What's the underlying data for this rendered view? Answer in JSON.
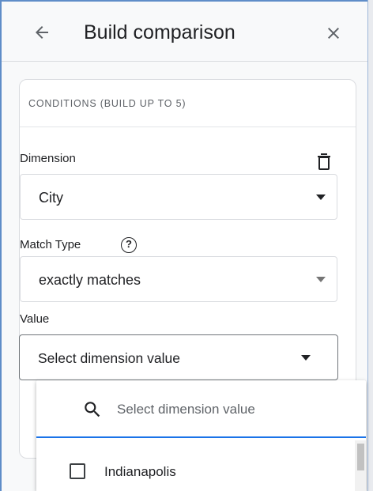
{
  "header": {
    "title": "Build comparison",
    "back_icon": "arrow-back-icon",
    "close_icon": "close-icon"
  },
  "conditions": {
    "heading": "CONDITIONS (BUILD UP TO 5)",
    "dimension": {
      "label": "Dimension",
      "value": "City",
      "delete_icon": "trash-icon"
    },
    "match_type": {
      "label": "Match Type",
      "value": "exactly matches",
      "help_glyph": "?"
    },
    "value": {
      "label": "Value",
      "placeholder": "Select dimension value"
    }
  },
  "dropdown": {
    "search_placeholder": "Select dimension value",
    "search_icon": "search-icon",
    "options": [
      {
        "label": "Indianapolis",
        "checked": false
      }
    ]
  },
  "colors": {
    "accent": "#1a73e8",
    "panel_bg": "#f8f9fa",
    "border": "#dadce0"
  }
}
